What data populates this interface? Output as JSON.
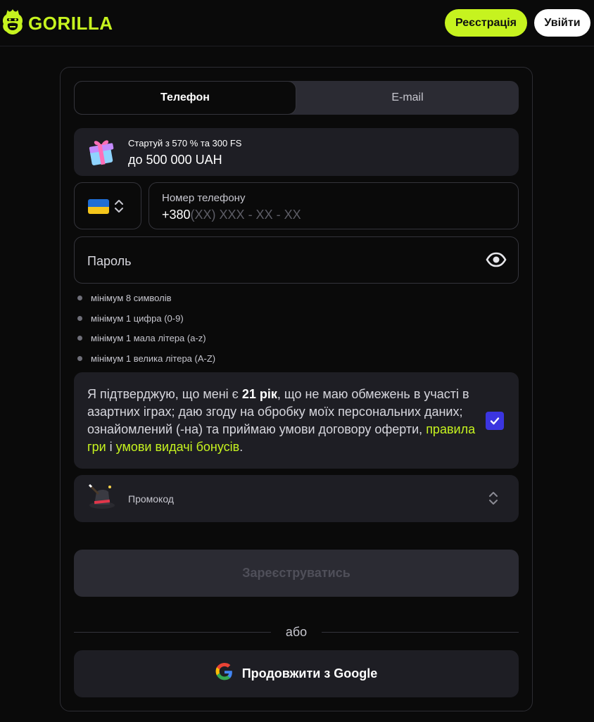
{
  "header": {
    "logo_text": "GORILLA",
    "register_label": "Реєстрація",
    "login_label": "Увійти"
  },
  "tabs": [
    {
      "label": "Телефон",
      "active": true
    },
    {
      "label": "E-mail",
      "active": false
    }
  ],
  "bonus": {
    "line1": "Стартуй з 570 % та 300 FS",
    "line2": "до 500 000 UAH",
    "icon": "gift-icon"
  },
  "phone": {
    "country_flag": "ukraine-flag-icon",
    "label": "Номер телефону",
    "prefix": "+380",
    "mask": "(XX) XXX - XX - XX"
  },
  "password": {
    "label": "Пароль",
    "icon": "eye-icon"
  },
  "password_rules": [
    "мінімум 8 символів",
    "мінімум 1 цифра (0-9)",
    "мінімум 1 мала літера (a-z)",
    "мінімум 1 велика літера (A-Z)"
  ],
  "consent": {
    "text_before": "Я підтверджую, що мені є ",
    "age": "21 рік",
    "text_middle": ", що не маю обмежень в участі в азартних іграх; даю згоду на обробку моїх персональних даних; ознайомлений (-на) та приймаю умови договору оферти, ",
    "link_rules": "правила гри",
    "and": " і ",
    "link_bonus": "умови видачі бонусів",
    "end": ".",
    "checked": true
  },
  "promo": {
    "label": "Промокод",
    "icon": "magic-hat-icon"
  },
  "submit_label": "Зареєструватись",
  "divider_label": "або",
  "google_label": "Продовжити з Google",
  "colors": {
    "accent": "#c6f31f",
    "background": "#0a0a0a",
    "panel": "#1e1e24",
    "checkbox": "#3b35e0"
  }
}
